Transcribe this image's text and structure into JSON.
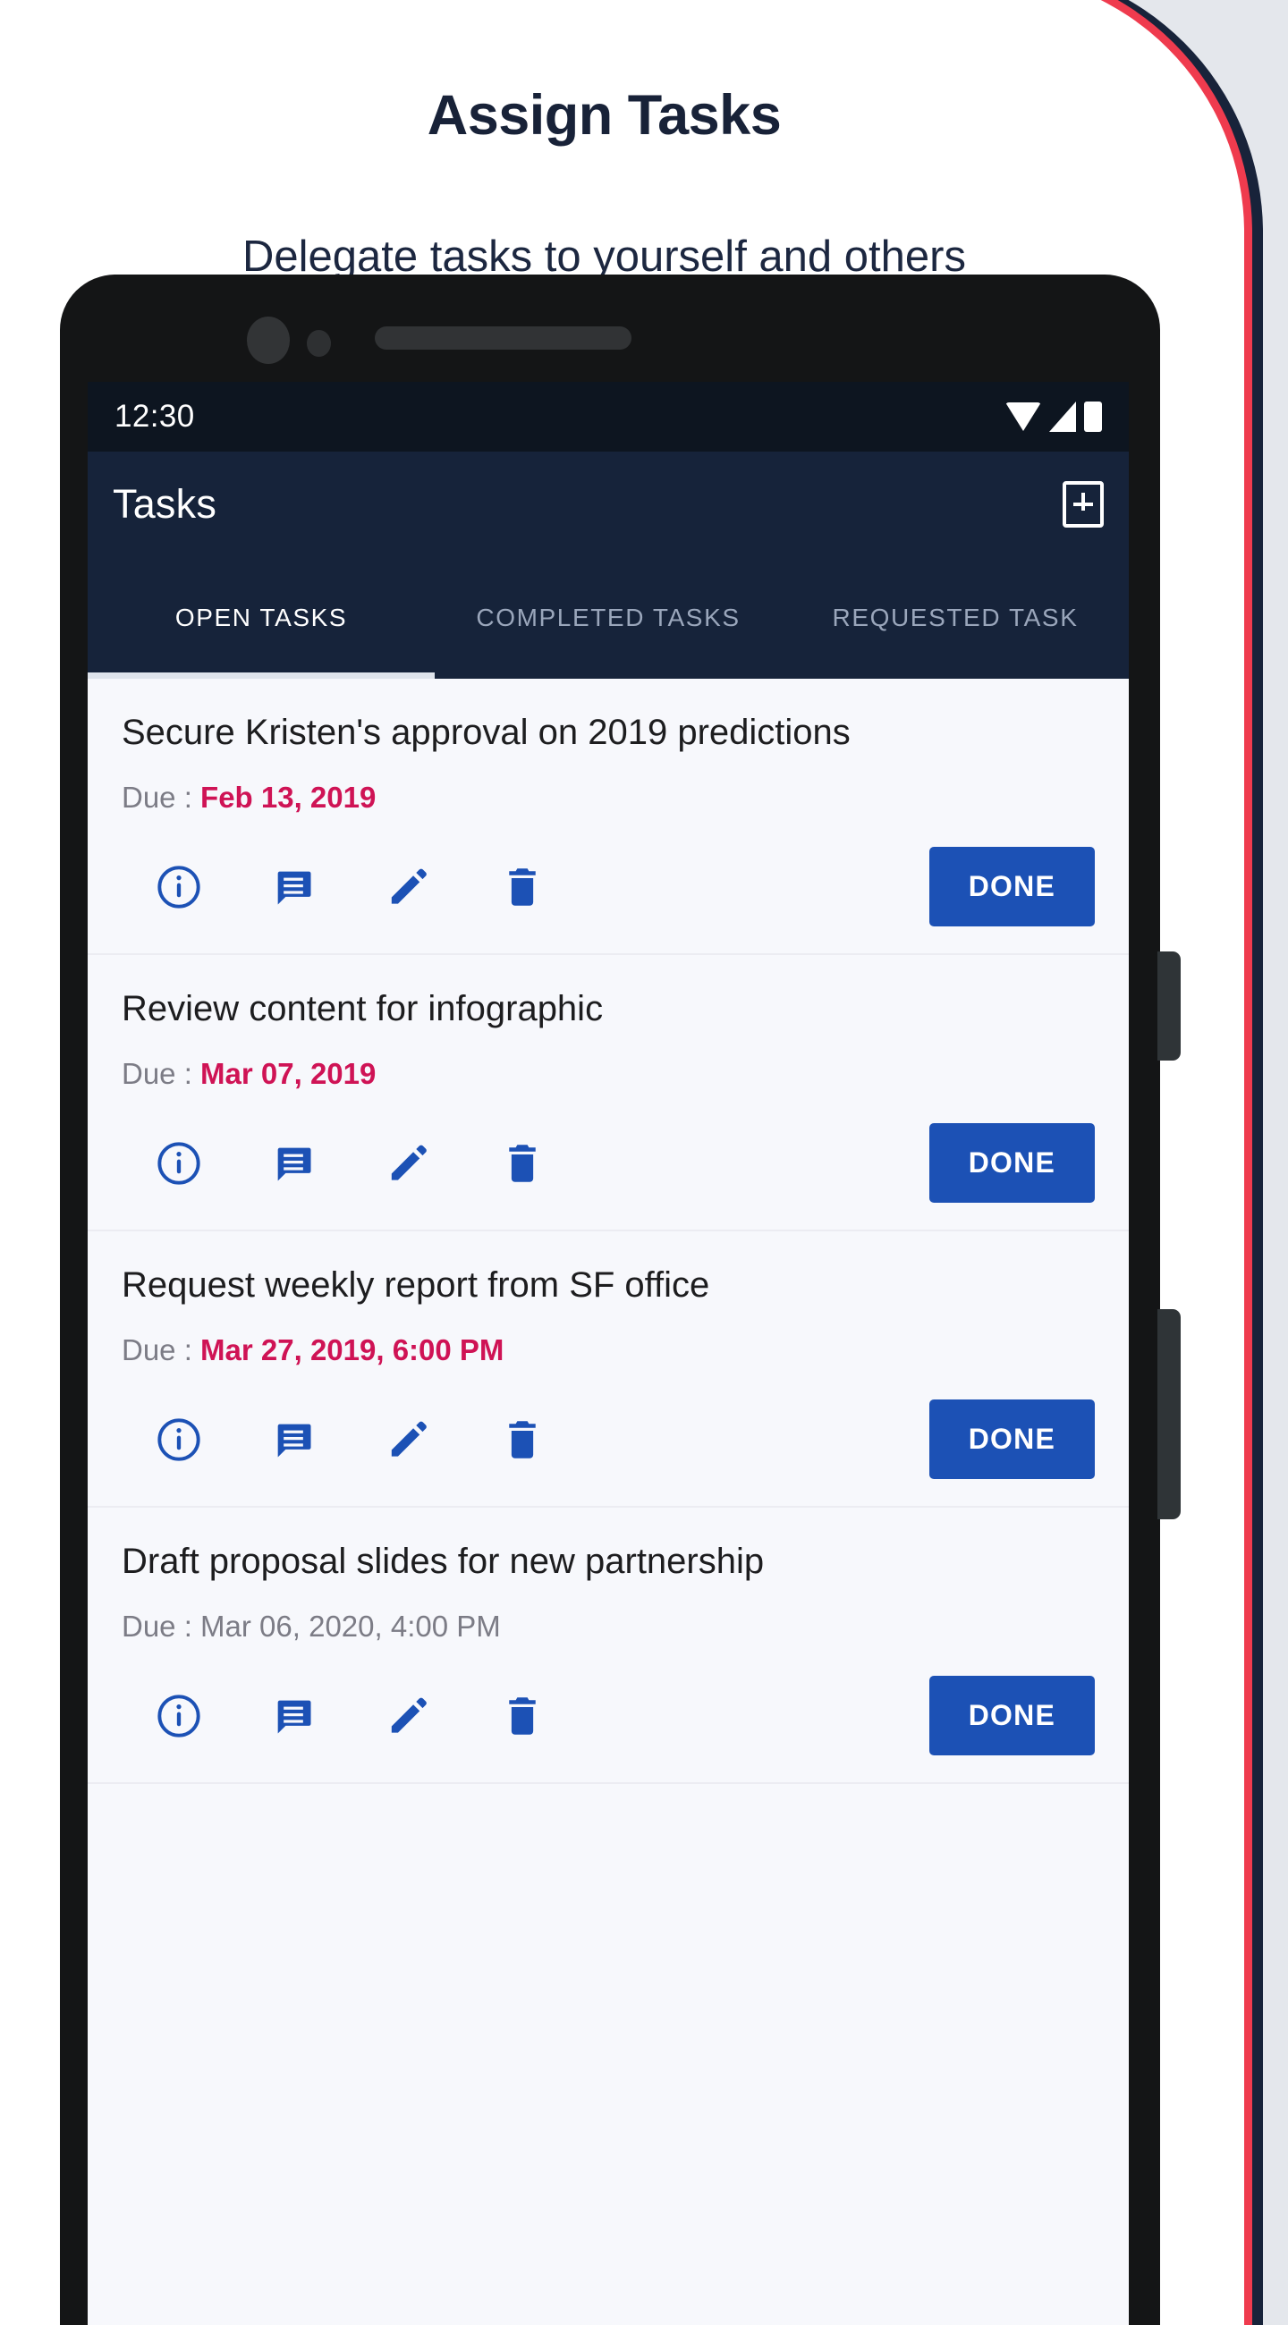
{
  "promo": {
    "headline": "Assign Tasks",
    "subhead": "Delegate tasks to yourself and others",
    "accent_red": "#ef3b4e",
    "frame_navy": "#18233a"
  },
  "phone": {
    "camera_icon": "camera-lens",
    "sensor_icon": "sensor-dot",
    "speaker_icon": "earpiece-speaker",
    "power_button": "power-button",
    "volume_button": "volume-button"
  },
  "status_bar": {
    "time": "12:30",
    "icons": [
      "wifi-icon",
      "signal-icon",
      "battery-icon"
    ],
    "background": "#0d1520"
  },
  "app_bar": {
    "title": "Tasks",
    "add_button": "add-task-icon",
    "background": "#16233a"
  },
  "tabs": [
    {
      "label": "OPEN TASKS",
      "active": true
    },
    {
      "label": "COMPLETED TASKS",
      "active": false
    },
    {
      "label": "REQUESTED TASK",
      "active": false
    }
  ],
  "task_actions": {
    "info_label": "info-icon",
    "comment_label": "comment-icon",
    "edit_label": "edit-icon",
    "delete_label": "delete-icon",
    "done_label": "DONE",
    "accent_blue": "#1c51b5"
  },
  "due_prefix": "Due : ",
  "tasks": [
    {
      "title": "Secure Kristen's approval on 2019 predictions",
      "due_label": "Due : ",
      "due_value": "Feb 13, 2019",
      "overdue": true,
      "done_label": "DONE"
    },
    {
      "title": "Review content for infographic",
      "due_label": "Due : ",
      "due_value": "Mar 07, 2019",
      "overdue": true,
      "done_label": "DONE"
    },
    {
      "title": "Request weekly report from SF office",
      "due_label": "Due : ",
      "due_value": "Mar 27, 2019, 6:00 PM",
      "overdue": true,
      "done_label": "DONE"
    },
    {
      "title": "Draft proposal slides for new partnership",
      "due_label": "Due : ",
      "due_value": "Mar 06, 2020, 4:00 PM",
      "overdue": false,
      "done_label": "DONE"
    }
  ]
}
